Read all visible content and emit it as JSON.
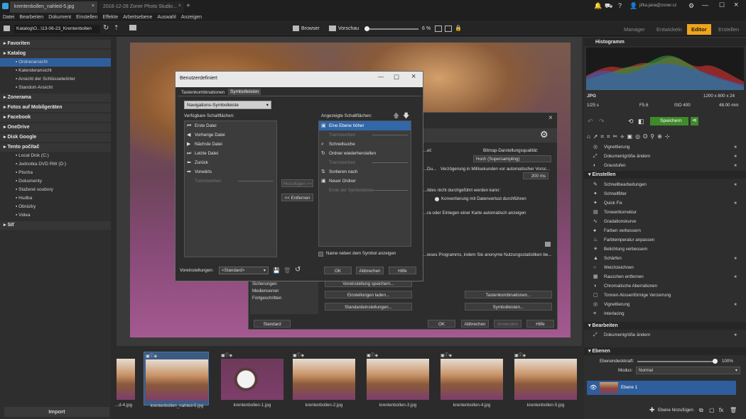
{
  "window": {
    "tab_active": "krentenbollen_nahled-5.jpg",
    "tab_inactive": "2016-12-28 Zoner Photo Studio..."
  },
  "menu": [
    "Datei",
    "Bearbeiten",
    "Dokument",
    "Einstellen",
    "Effekte",
    "Arbeitsebene",
    "Auswahl",
    "Anzeigen"
  ],
  "toolbar": {
    "path": "Katalog\\O...\\13-06-23_Krentenbollen",
    "browser": "Browser",
    "preview": "Vorschau",
    "zoom": "6 %"
  },
  "modes": {
    "manager": "Manager",
    "develop": "Entwickeln",
    "editor": "Editor",
    "create": "Erstellen"
  },
  "account": "jiřka.jana@zoner.cz",
  "nav": [
    {
      "label": "Favoriten",
      "level": 0,
      "hdr": true
    },
    {
      "label": "Katalog",
      "level": 0,
      "hdr": true
    },
    {
      "label": "Ordneransicht",
      "level": 1,
      "sel": true
    },
    {
      "label": "Kalenderansicht",
      "level": 1
    },
    {
      "label": "Ansicht der Schlüsselwörter",
      "level": 1
    },
    {
      "label": "Standort-Ansicht",
      "level": 1
    },
    {
      "label": "Zonerama",
      "level": 0,
      "hdr": true
    },
    {
      "label": "Fotos auf Mobilgeräten",
      "level": 0,
      "hdr": true
    },
    {
      "label": "Facebook",
      "level": 0,
      "hdr": true
    },
    {
      "label": "OneDrive",
      "level": 0,
      "hdr": true
    },
    {
      "label": "Disk Google",
      "level": 0,
      "hdr": true
    },
    {
      "label": "Tento počítač",
      "level": 0,
      "hdr": true
    },
    {
      "label": "Local Disk (C:)",
      "level": 1
    },
    {
      "label": "Jednotka DVD RW (D:)",
      "level": 1
    },
    {
      "label": "Plocha",
      "level": 1
    },
    {
      "label": "Dokumenty",
      "level": 1
    },
    {
      "label": "Stažené soubory",
      "level": 1
    },
    {
      "label": "Hudba",
      "level": 1
    },
    {
      "label": "Obrázky",
      "level": 1
    },
    {
      "label": "Videa",
      "level": 1
    },
    {
      "label": "Síť",
      "level": 0,
      "hdr": true
    }
  ],
  "import": "Import",
  "back_dialog": {
    "close": "×",
    "lines": [
      "...et:",
      "Bitmap-Darstellungsqualität:",
      "Hoch (Supersampling)",
      "...Du...",
      "Verzögerung in Millisekunden vor automatischer Vorsc...",
      "200 ms",
      "...ildes nicht durchgeführt werden kann:",
      "Konvertierung mit Datenverlust durchführen",
      "...ra oder Einlegen einer Karte automatisch anzeigen",
      "...ieses Programms, indem Sie anonyme Nutzungsstatistiken be..."
    ],
    "sidebar": [
      "Sicherungen",
      "Medienserver",
      "Fortgeschritten"
    ],
    "btn_save": "Voreinstellung speichern...",
    "btn_load": "Einstellungen laden...",
    "btn_defaults": "Standardeinstellungen...",
    "btn_shortcuts": "Tastenkombinationen...",
    "btn_toolbars": "Symbolleisten...",
    "btn_standard": "Standard",
    "btn_ok": "OK",
    "btn_cancel": "Abbrechen",
    "btn_apply": "Anwenden",
    "btn_help": "Hilfe"
  },
  "dialog": {
    "title": "Benutzerdefiniert",
    "tab1": "Tastenkombinationen",
    "tab2": "Symbolleisten",
    "dropdown": "Navigations-Symbolleiste",
    "available_label": "Verfügbare Schaltflächen:",
    "displayed_label": "Angezeigte Schaltflächen:",
    "available": [
      {
        "label": "Erste Datei",
        "icon": "⏮"
      },
      {
        "label": "Vorherige Datei",
        "icon": "◀"
      },
      {
        "label": "Nächste Datei",
        "icon": "▶"
      },
      {
        "label": "Letzte Datei",
        "icon": "⏭"
      },
      {
        "label": "Zurück",
        "icon": "⬅"
      },
      {
        "label": "Vorwärts",
        "icon": "➡"
      },
      {
        "label": "Trennzeichen",
        "icon": "",
        "sep": true
      }
    ],
    "displayed": [
      {
        "label": "Eine Ebene höher",
        "icon": "▣",
        "sel": true
      },
      {
        "label": "Trennzeichen",
        "icon": "",
        "sep": true
      },
      {
        "label": "Schnellsuche",
        "icon": "⌕"
      },
      {
        "label": "Ordner wiederherstellen",
        "icon": "↻"
      },
      {
        "label": "Trennzeichen",
        "icon": "",
        "sep": true
      },
      {
        "label": "Sortieren nach",
        "icon": "⇅"
      },
      {
        "label": "Neuer Ordner",
        "icon": "▣"
      },
      {
        "label": "Ende der Symbolleiste",
        "icon": "",
        "sep": true
      }
    ],
    "add_btn": "Hinzufügen >>",
    "remove_btn": "<< Entfernen",
    "checkbox": "Name neben dem Symbol anzeigen",
    "preset_label": "Voreinstellungen:",
    "preset_value": "<Standard>",
    "ok": "OK",
    "cancel": "Abbrechen",
    "help": "Hilfe"
  },
  "thumbs": [
    {
      "name": "...d-4.jpg"
    },
    {
      "name": "krentenbollen_nahled-5.jpg"
    },
    {
      "name": "krentenbollen-1.jpg"
    },
    {
      "name": "krentenbollen-2.jpg"
    },
    {
      "name": "krentenbollen-3.jpg"
    },
    {
      "name": "krentenbollen-4.jpg"
    },
    {
      "name": "krentenbollen-5.jpg"
    }
  ],
  "histogram": {
    "title": "Histogramm",
    "file_type": "JPG",
    "dims": "1200 x 800 x 24",
    "shutter": "1/25 s",
    "aperture": "F5.6",
    "iso": "ISO 400",
    "focal": "48.00 mm"
  },
  "save": "Speichern",
  "tools_top": [
    {
      "label": "Vignettierung",
      "icon": "◎",
      "star": true
    },
    {
      "label": "Dokumentgröße ändern",
      "icon": "⤢",
      "star": true
    },
    {
      "label": "Graustufen",
      "icon": "◐",
      "star": true
    }
  ],
  "section_adjust": "Einstellen",
  "tools_adjust": [
    {
      "label": "Schnellbearbeitungen",
      "icon": "✎",
      "star": true
    },
    {
      "label": "Schnellfilter",
      "icon": "✦",
      "star": false
    },
    {
      "label": "Quick Fix",
      "icon": "✦",
      "star": true
    },
    {
      "label": "Tonwertkorrektur",
      "icon": "▤",
      "star": false
    },
    {
      "label": "Gradationskurve",
      "icon": "∿",
      "star": false
    },
    {
      "label": "Farben verbessern",
      "icon": "●",
      "star": false
    },
    {
      "label": "Farbtemperatur anpassen",
      "icon": "♨",
      "star": false
    },
    {
      "label": "Belichtung verbessern",
      "icon": "☀",
      "star": false
    },
    {
      "label": "Schärfen",
      "icon": "▲",
      "star": true
    },
    {
      "label": "Weichzeichnen",
      "icon": "○",
      "star": false
    },
    {
      "label": "Rauschen entfernen",
      "icon": "▦",
      "star": true
    },
    {
      "label": "Chromatische Aberrationen",
      "icon": "◑",
      "star": false
    },
    {
      "label": "Tonnen-/kissenförmige Verzerrung",
      "icon": "▢",
      "star": false
    },
    {
      "label": "Vignettierung",
      "icon": "◎",
      "star": true
    },
    {
      "label": "Interlacing",
      "icon": "≡",
      "star": false
    }
  ],
  "section_edit": "Bearbeiten",
  "tools_edit": [
    {
      "label": "Dokumentgröße ändern",
      "icon": "⤢",
      "star": true
    }
  ],
  "layers": {
    "title": "Ebenen",
    "opacity_label": "Ebenendeckkraft:",
    "opacity": "100%",
    "mode_label": "Modus:",
    "mode": "Normal",
    "layer_name": "Ebene 1",
    "add_layer": "Ebene hinzufügen"
  },
  "colors": {
    "accent": "#f0a419",
    "selection": "#2f5e9c"
  }
}
